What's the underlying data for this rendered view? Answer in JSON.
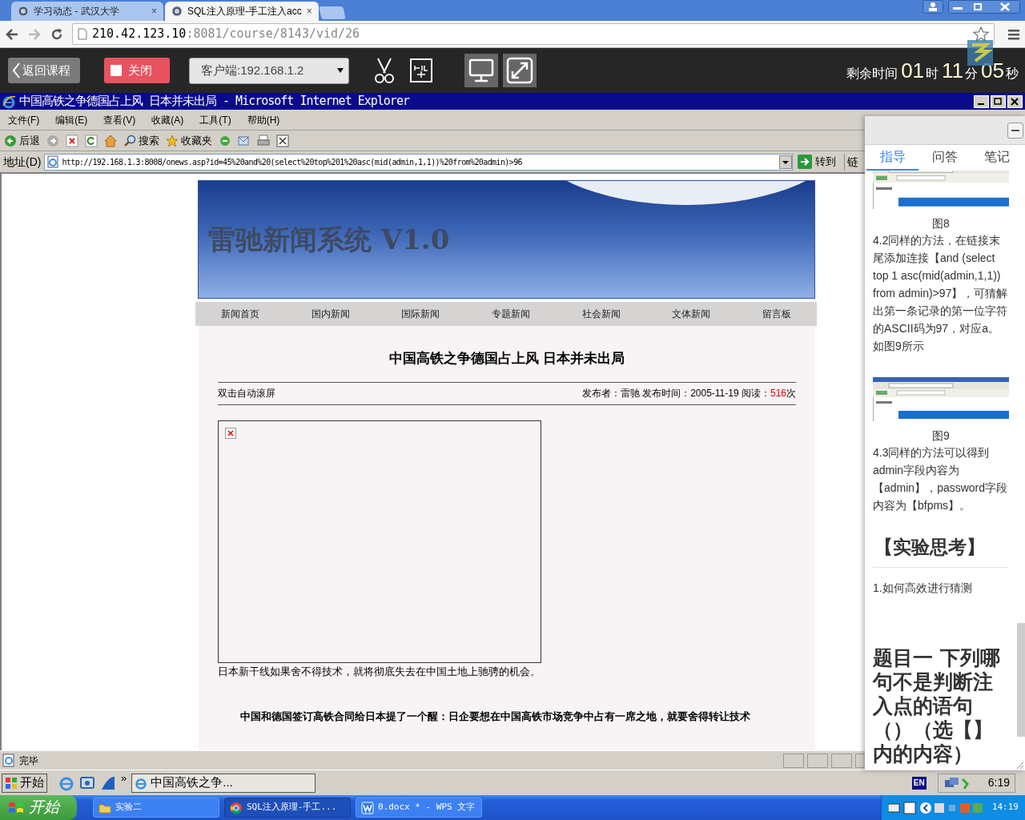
{
  "browser": {
    "tabs": [
      {
        "title": "学习动态 - 武汉大学",
        "close": "×",
        "selected": false
      },
      {
        "title": "SQL注入原理-手工注入acc",
        "close": "×",
        "selected": true
      }
    ],
    "address": {
      "host": "210.42.123.10",
      "path": ":8081/course/8143/vid/26"
    }
  },
  "toolbar": {
    "back_label": "返回课程",
    "close_label": "关闭",
    "client_select": "客户端:192.168.1.2",
    "timer": {
      "label": "剩余时间",
      "hours": "01",
      "hours_unit": "时",
      "minutes": "11",
      "minutes_unit": "分",
      "seconds": "05",
      "seconds_unit": "秒"
    }
  },
  "ie": {
    "title": "中国高铁之争德国占上风 日本并未出局 - Microsoft Internet Explorer",
    "menu": [
      "文件(F)",
      "编辑(E)",
      "查看(V)",
      "收藏(A)",
      "工具(T)",
      "帮助(H)"
    ],
    "buttons": [
      {
        "kind": "back",
        "label": "后退"
      },
      {
        "kind": "forward"
      },
      {
        "kind": "stop"
      },
      {
        "kind": "refresh"
      },
      {
        "kind": "home"
      },
      {
        "kind": "search",
        "label": "搜索"
      },
      {
        "kind": "favorites",
        "label": "收藏夹"
      },
      {
        "kind": "media"
      },
      {
        "kind": "mail"
      },
      {
        "kind": "print"
      },
      {
        "kind": "edit"
      }
    ],
    "address_label": "地址(D)",
    "url": "http://192.168.1.3:8008/onews.asp?id=45%20and%20(select%20top%201%20asc(mid(admin,1,1))%20from%20admin)>96",
    "go_label": "转到",
    "links_label": "链",
    "status": "完毕"
  },
  "page": {
    "site_title": "雷驰新闻系统 V1.0",
    "nav": [
      "新闻首页",
      "国内新闻",
      "国际新闻",
      "专题新闻",
      "社会新闻",
      "文体新闻",
      "留言板"
    ],
    "article": {
      "title": "中国高铁之争德国占上风 日本并未出局",
      "autoscroll": "双击自动滚屏",
      "meta": "发布者：雷驰 发布时间：2005-11-19 阅读：",
      "reads": "516",
      "reads_suffix": "次",
      "caption": "日本新干线如果舍不得技术，就将彻底失去在中国土地上驰骋的机会。",
      "lead": "中国和德国签订高铁合同给日本提了一个醒：日企要想在中国高铁市场竞争中占有一席之地，就要舍得转让技术"
    }
  },
  "panel": {
    "tabs": [
      {
        "label": "指导",
        "selected": true
      },
      {
        "label": "问答",
        "selected": false
      },
      {
        "label": "笔记",
        "selected": false
      }
    ],
    "items": [
      {
        "kind": "figure"
      },
      {
        "kind": "caption",
        "text": "图8"
      },
      {
        "kind": "paragraph",
        "text": "4.2同样的方法，在链接末尾添加连接【and (select top 1 asc(mid(admin,1,1)) from admin)>97】，可猜解出第一条记录的第一位字符的ASCII码为97，对应a。如图9所示"
      },
      {
        "kind": "figure"
      },
      {
        "kind": "caption",
        "text": "图9"
      },
      {
        "kind": "paragraph",
        "text": "4.3同样的方法可以得到admin字段内容为【admin】，password字段内容为【bfpms】。"
      },
      {
        "kind": "heading",
        "text": "【实验思考】"
      },
      {
        "kind": "paragraph",
        "text": "1.如何高效进行猜测"
      },
      {
        "kind": "question",
        "text": "题目一 下列哪句不是判断注入点的语句（）（选【】内的内容）"
      }
    ]
  },
  "inner_taskbar": {
    "start": "开始",
    "window": "中国高铁之争...",
    "quick_more": "»",
    "language": "EN",
    "clock": "6:19"
  },
  "outer_taskbar": {
    "start": "开始",
    "items": [
      {
        "label": "实验二",
        "kind": "folder",
        "selected": false
      },
      {
        "label": "SQL注入原理-手工...",
        "kind": "chrome",
        "selected": true
      },
      {
        "label": "0.docx * - WPS 文字",
        "kind": "wps",
        "selected": false
      }
    ],
    "clock": "14:19"
  }
}
